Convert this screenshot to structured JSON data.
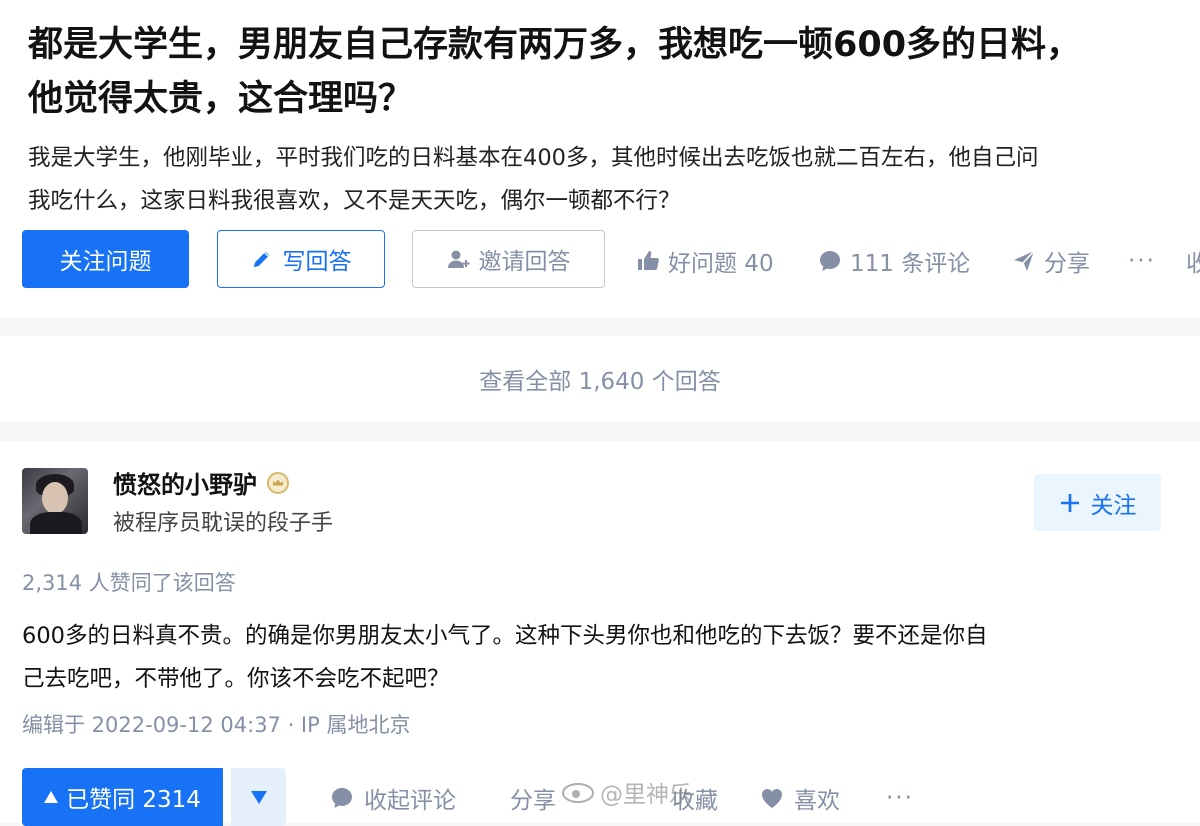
{
  "question": {
    "title_lines": [
      "都是大学生，男朋友自己存款有两万多，我想吃一顿600多的日料，",
      "他觉得太贵，这合理吗？"
    ],
    "desc_lines": [
      "我是大学生，他刚毕业，平时我们吃的日料基本在400多，其他时候出去吃饭也就二百左右，他自己问",
      "我吃什么，这家日料我很喜欢，又不是天天吃，偶尔一顿都不行？"
    ],
    "buttons": {
      "follow": "关注问题",
      "write": "写回答",
      "invite": "邀请回答"
    },
    "actions": {
      "good": "好问题 40",
      "comments": "111 条评论",
      "share": "分享",
      "more": "···",
      "edge": "收"
    }
  },
  "view_all": "查看全部 1,640 个回答",
  "answer": {
    "author": {
      "name": "愤怒的小野驴",
      "bio": "被程序员耽误的段子手",
      "follow_label": "关注"
    },
    "agree_count_text": "2,314 人赞同了该回答",
    "content_lines": [
      "600多的日料真不贵。的确是你男朋友太小气了。这种下头男你也和他吃的下去饭？要不还是你自",
      "己去吃吧，不带他了。你该不会吃不起吧？"
    ],
    "meta": "编辑于 2022-09-12 04:37 · IP 属地北京",
    "bar": {
      "upvote": "已赞同 2314",
      "collapse_comments": "收起评论",
      "share": "分享",
      "favorite": "收藏",
      "like": "喜欢",
      "more": "···"
    }
  },
  "watermark": "@里神乐",
  "colors": {
    "brand_blue": "#1772f6",
    "muted": "#8590a6",
    "follow_bg": "#ebf5fd"
  }
}
